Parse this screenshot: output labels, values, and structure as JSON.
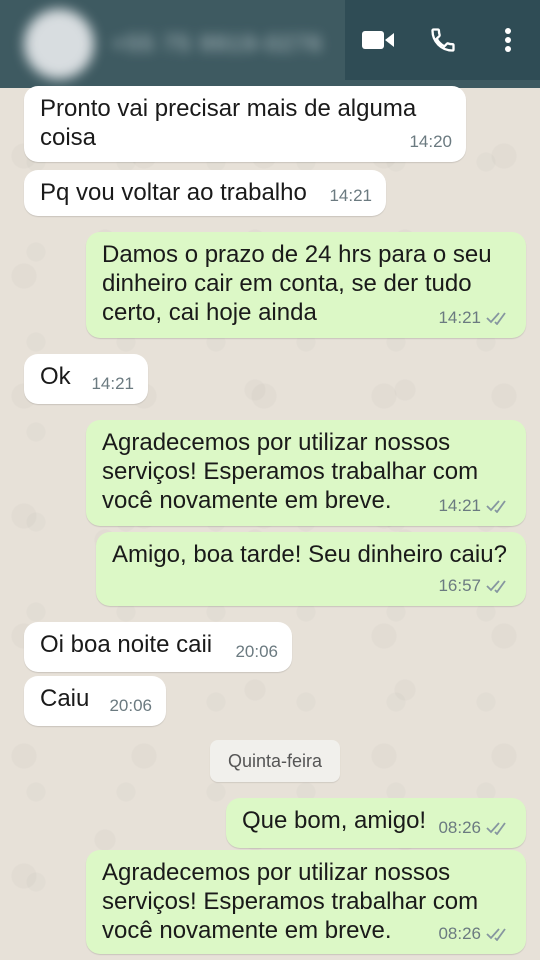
{
  "header": {
    "contact_name_blurred": "+55 75 9919-0276",
    "icons": [
      "video-call-icon",
      "phone-call-icon",
      "more-options-icon"
    ]
  },
  "messages": [
    {
      "direction": "in",
      "lines": [
        "Pronto vai precisar mais de alguma",
        "coisa"
      ],
      "time": "14:20"
    },
    {
      "direction": "in",
      "lines": [
        "Pq vou voltar ao trabalho"
      ],
      "time": "14:21"
    },
    {
      "direction": "out",
      "lines": [
        "Damos o prazo de 24 hrs para o seu",
        "dinheiro cair em conta, se der tudo",
        "certo, cai hoje ainda"
      ],
      "time": "14:21",
      "status": "read"
    },
    {
      "direction": "in",
      "lines": [
        "Ok"
      ],
      "time": "14:21"
    },
    {
      "direction": "out",
      "lines": [
        "Agradecemos por utilizar nossos",
        "serviços! Esperamos trabalhar com",
        "você novamente em breve."
      ],
      "time": "14:21",
      "status": "read"
    },
    {
      "direction": "out",
      "lines": [
        "Amigo, boa tarde! Seu dinheiro caiu?"
      ],
      "time": "16:57",
      "status": "read"
    },
    {
      "direction": "in",
      "lines": [
        "Oi boa noite caii"
      ],
      "time": "20:06"
    },
    {
      "direction": "in",
      "lines": [
        "Caiu"
      ],
      "time": "20:06"
    },
    {
      "direction": "out",
      "lines": [
        "Que bom, amigo!"
      ],
      "time": "08:26",
      "status": "read"
    },
    {
      "direction": "out",
      "lines": [
        "Agradecemos por utilizar nossos",
        "serviços! Esperamos trabalhar com",
        "você novamente em breve."
      ],
      "time": "08:26",
      "status": "read"
    }
  ],
  "day_separator": "Quinta-feira",
  "colors": {
    "header": "#3E5A61",
    "incoming_bubble": "#FFFFFF",
    "outgoing_bubble": "#DCF8C6",
    "chat_background": "#E7E1D8",
    "tick_color": "#8696A0"
  }
}
